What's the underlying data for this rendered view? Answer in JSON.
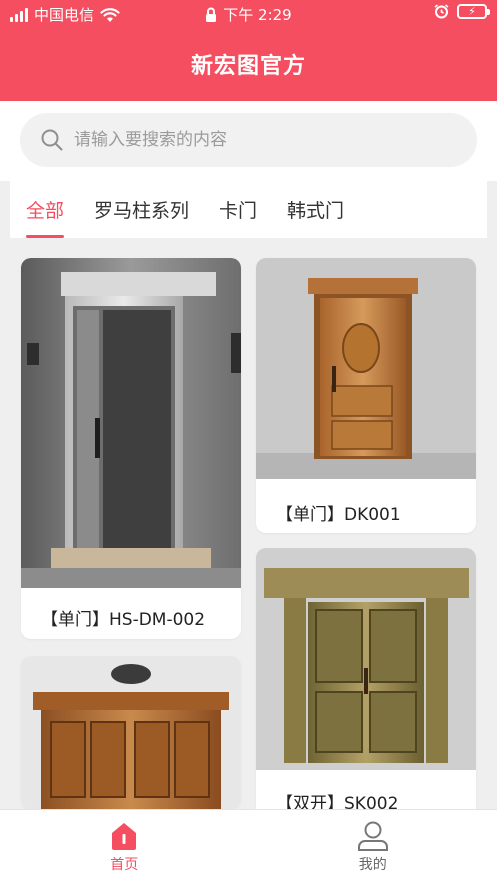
{
  "status_bar": {
    "carrier": "中国电信",
    "time": "下午 2:29",
    "battery": "⚡"
  },
  "header": {
    "title": "新宏图官方"
  },
  "search": {
    "placeholder": "请输入要搜索的内容",
    "value": ""
  },
  "tabs": [
    {
      "label": "全部",
      "active": true
    },
    {
      "label": "罗马柱系列",
      "active": false
    },
    {
      "label": "卡门",
      "active": false
    },
    {
      "label": "韩式门",
      "active": false
    }
  ],
  "products": [
    {
      "title": "【单门】HS-DM-002",
      "icon": "grey-modern-door-photo"
    },
    {
      "title": "【单门】DK001",
      "icon": "copper-single-door-photo"
    },
    {
      "title": "【双开】SK002",
      "icon": "bronze-double-door-photo"
    },
    {
      "title": "",
      "icon": "copper-four-panel-door-photo"
    }
  ],
  "bottom_nav": [
    {
      "label": "首页",
      "icon": "home-icon",
      "active": true
    },
    {
      "label": "我的",
      "icon": "user-icon",
      "active": false
    }
  ],
  "colors": {
    "brand": "#f44e60",
    "background": "#efefef"
  }
}
